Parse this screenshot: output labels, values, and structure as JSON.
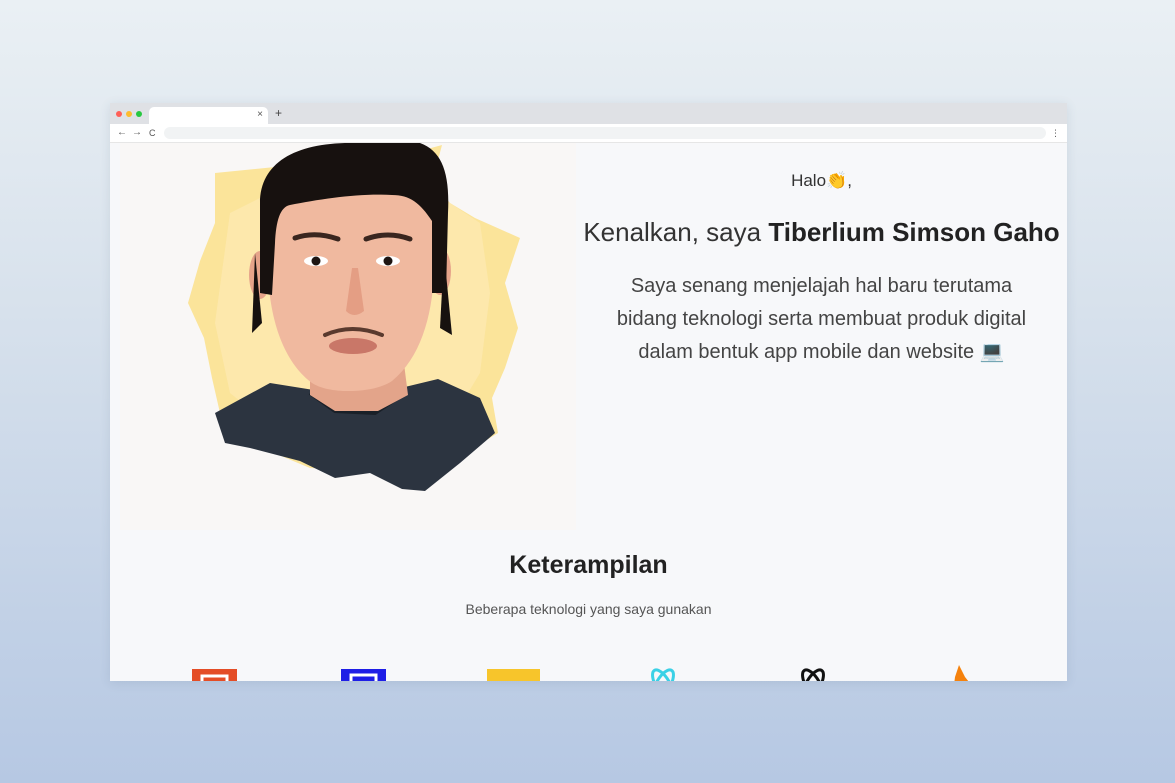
{
  "browser": {
    "tab_close": "×",
    "new_tab": "+",
    "back": "←",
    "forward": "→",
    "reload": "C",
    "menu": "⋮"
  },
  "hero": {
    "greeting": "Halo👏,",
    "intro_prefix": "Kenalkan, saya ",
    "intro_name": "Tiberlium Simson Gaho",
    "bio": "Saya senang menjelajah hal baru terutama bidang teknologi serta membuat produk digital dalam bentuk app mobile dan website 💻"
  },
  "skills": {
    "title": "Keterampilan",
    "subtitle": "Beberapa teknologi yang saya gunakan",
    "icons": [
      "html5-icon",
      "css3-icon",
      "javascript-icon",
      "react-icon",
      "nextjs-icon",
      "firebase-icon"
    ]
  },
  "colors": {
    "html5": "#e44d26",
    "css3": "#1e1ee6",
    "javascript": "#f7c52b",
    "react": "#3ad1e6",
    "nextjs": "#111111",
    "firebase": "#f5820d"
  }
}
